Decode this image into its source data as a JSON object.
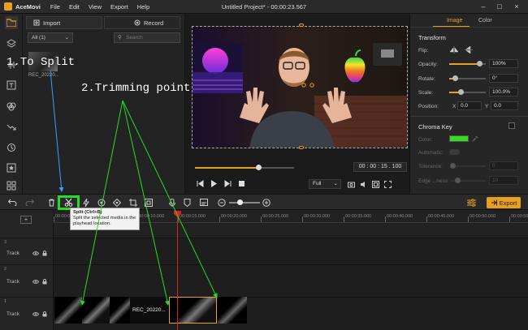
{
  "app": {
    "name": "AceMovi",
    "title": "Untitled Project* - 00:00:23.567",
    "menus": [
      "File",
      "Edit",
      "View",
      "Export",
      "Help"
    ]
  },
  "media": {
    "import_label": "Import",
    "record_label": "Record",
    "filter_value": "All (1)",
    "search_placeholder": "Search",
    "clip_name": "REC_20220..."
  },
  "preview": {
    "timecode": "00 : 00 : 15 . 100",
    "quality": "Full",
    "progress": 0.64
  },
  "properties": {
    "tabs": [
      "Image",
      "Color"
    ],
    "transform_title": "Transform",
    "flip_label": "Flip:",
    "opacity_label": "Opacity:",
    "opacity_value": "100%",
    "opacity_level": 0.82,
    "rotate_label": "Rotate:",
    "rotate_value": "0°",
    "rotate_level": 0.15,
    "scale_label": "Scale:",
    "scale_value": "100.0%",
    "scale_level": 0.3,
    "position_label": "Position:",
    "pos_x_label": "X",
    "pos_x": "0.0",
    "pos_y_label": "Y",
    "pos_y": "0.0",
    "chroma_title": "Chroma Key",
    "color_label": "Color:",
    "automatic_label": "Automatic:",
    "tolerance_label": "Tolerance:",
    "tolerance_value": "0",
    "edge_label": "Edge ...ness:",
    "edge_value": "10",
    "accent": "#e8a020",
    "chroma_color": "#33dd22"
  },
  "toolbar": {
    "export_label": "Export"
  },
  "tooltip": {
    "title": "Split (Ctrl+B)",
    "body": "Split the selected media in the playhead location."
  },
  "ruler": {
    "ticks": [
      "00:00:00.000",
      "00:00:05.000",
      "00:00:10.000",
      "00:00:15.000",
      "00:00:20.000",
      "00:00:25.000",
      "00:00:30.000",
      "00:00:35.000",
      "00:00:40.000",
      "00:00:45.000",
      "00:00:50.000",
      "00:00:55.000"
    ]
  },
  "timeline": {
    "tracks": [
      {
        "num": "3",
        "label": "Track"
      },
      {
        "num": "2",
        "label": "Track"
      },
      {
        "num": "1",
        "label": "Track"
      }
    ],
    "clip_label": "REC_20220..."
  },
  "annotations": {
    "split": "1.To Split",
    "trim": "2.Trimming point"
  }
}
